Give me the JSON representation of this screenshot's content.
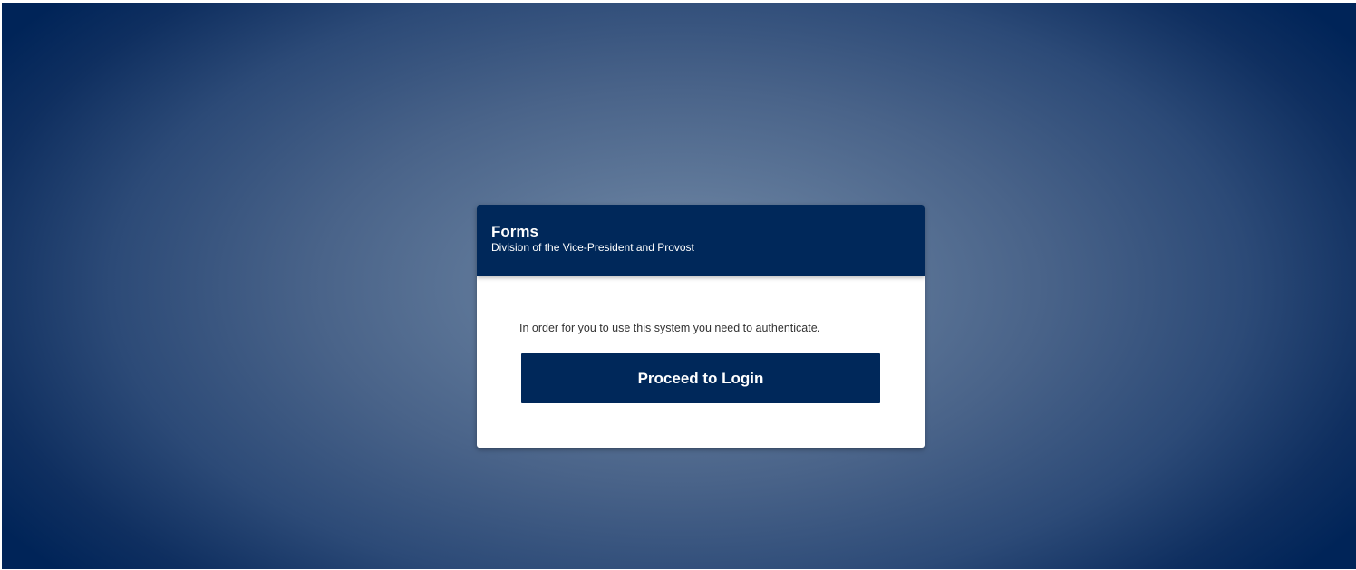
{
  "card": {
    "title": "Forms",
    "subtitle": "Division of the Vice-President and Provost"
  },
  "body": {
    "message": "In order for you to use this system you need to authenticate.",
    "login_button_label": "Proceed to Login"
  },
  "colors": {
    "brand_navy": "#00285a",
    "background_center": "#7b8fab",
    "background_edge": "#002458",
    "card_background": "#ffffff"
  }
}
